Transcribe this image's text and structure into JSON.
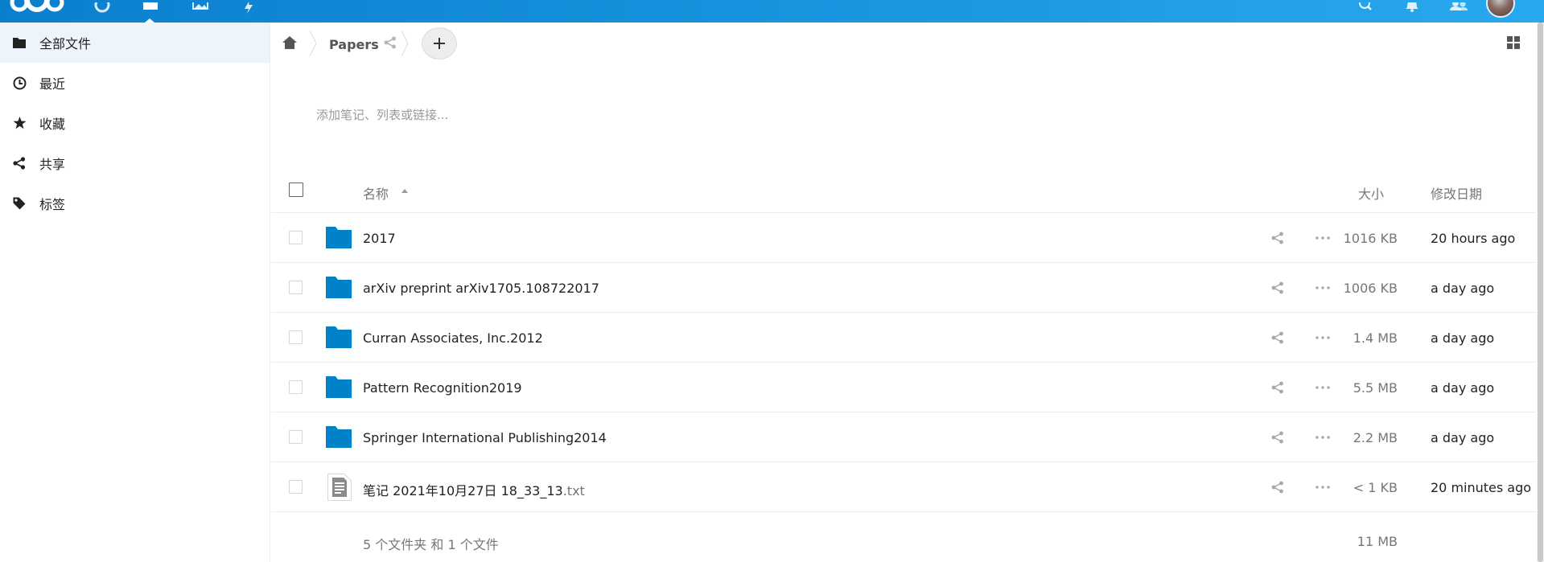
{
  "colors": {
    "header_start": "#0a7fce",
    "header_end": "#28a8ee",
    "folder": "#0082c9",
    "sidebar_active": "#eef4fc"
  },
  "header": {
    "apps": [
      {
        "name": "nextcloud-logo-icon"
      },
      {
        "name": "dashboard-icon"
      },
      {
        "name": "files-icon",
        "active": true
      },
      {
        "name": "photos-icon"
      },
      {
        "name": "activity-icon"
      }
    ],
    "right": [
      "search-icon",
      "notifications-icon",
      "contacts-icon",
      "avatar"
    ]
  },
  "sidebar": {
    "items": [
      {
        "label": "全部文件",
        "icon": "folder-icon",
        "active": true
      },
      {
        "label": "最近",
        "icon": "clock-icon"
      },
      {
        "label": "收藏",
        "icon": "star-icon"
      },
      {
        "label": "共享",
        "icon": "share-icon"
      },
      {
        "label": "标签",
        "icon": "tag-icon"
      }
    ]
  },
  "breadcrumb": {
    "home_icon": "home-icon",
    "current": "Papers",
    "share_icon": "share-icon",
    "add_icon": "plus-icon"
  },
  "notes": {
    "placeholder": "添加笔记、列表或链接..."
  },
  "table": {
    "headers": {
      "name": "名称",
      "size": "大小",
      "modified": "修改日期"
    },
    "sort_icon": "sort-ascending-icon",
    "rows": [
      {
        "type": "folder",
        "name": "2017",
        "ext": "",
        "size": "1016 KB",
        "modified": "20 hours ago"
      },
      {
        "type": "folder",
        "name": "arXiv preprint arXiv1705.108722017",
        "ext": "",
        "size": "1006 KB",
        "modified": "a day ago"
      },
      {
        "type": "folder",
        "name": "Curran Associates, Inc.2012",
        "ext": "",
        "size": "1.4 MB",
        "modified": "a day ago"
      },
      {
        "type": "folder",
        "name": "Pattern Recognition2019",
        "ext": "",
        "size": "5.5 MB",
        "modified": "a day ago"
      },
      {
        "type": "folder",
        "name": "Springer International Publishing2014",
        "ext": "",
        "size": "2.2 MB",
        "modified": "a day ago"
      },
      {
        "type": "file",
        "name": "笔记 2021年10月27日 18_33_13",
        "ext": ".txt",
        "size": "< 1 KB",
        "modified": "20 minutes ago"
      }
    ],
    "footer": {
      "summary": "5 个文件夹 和 1 个文件",
      "total_size": "11 MB"
    }
  }
}
